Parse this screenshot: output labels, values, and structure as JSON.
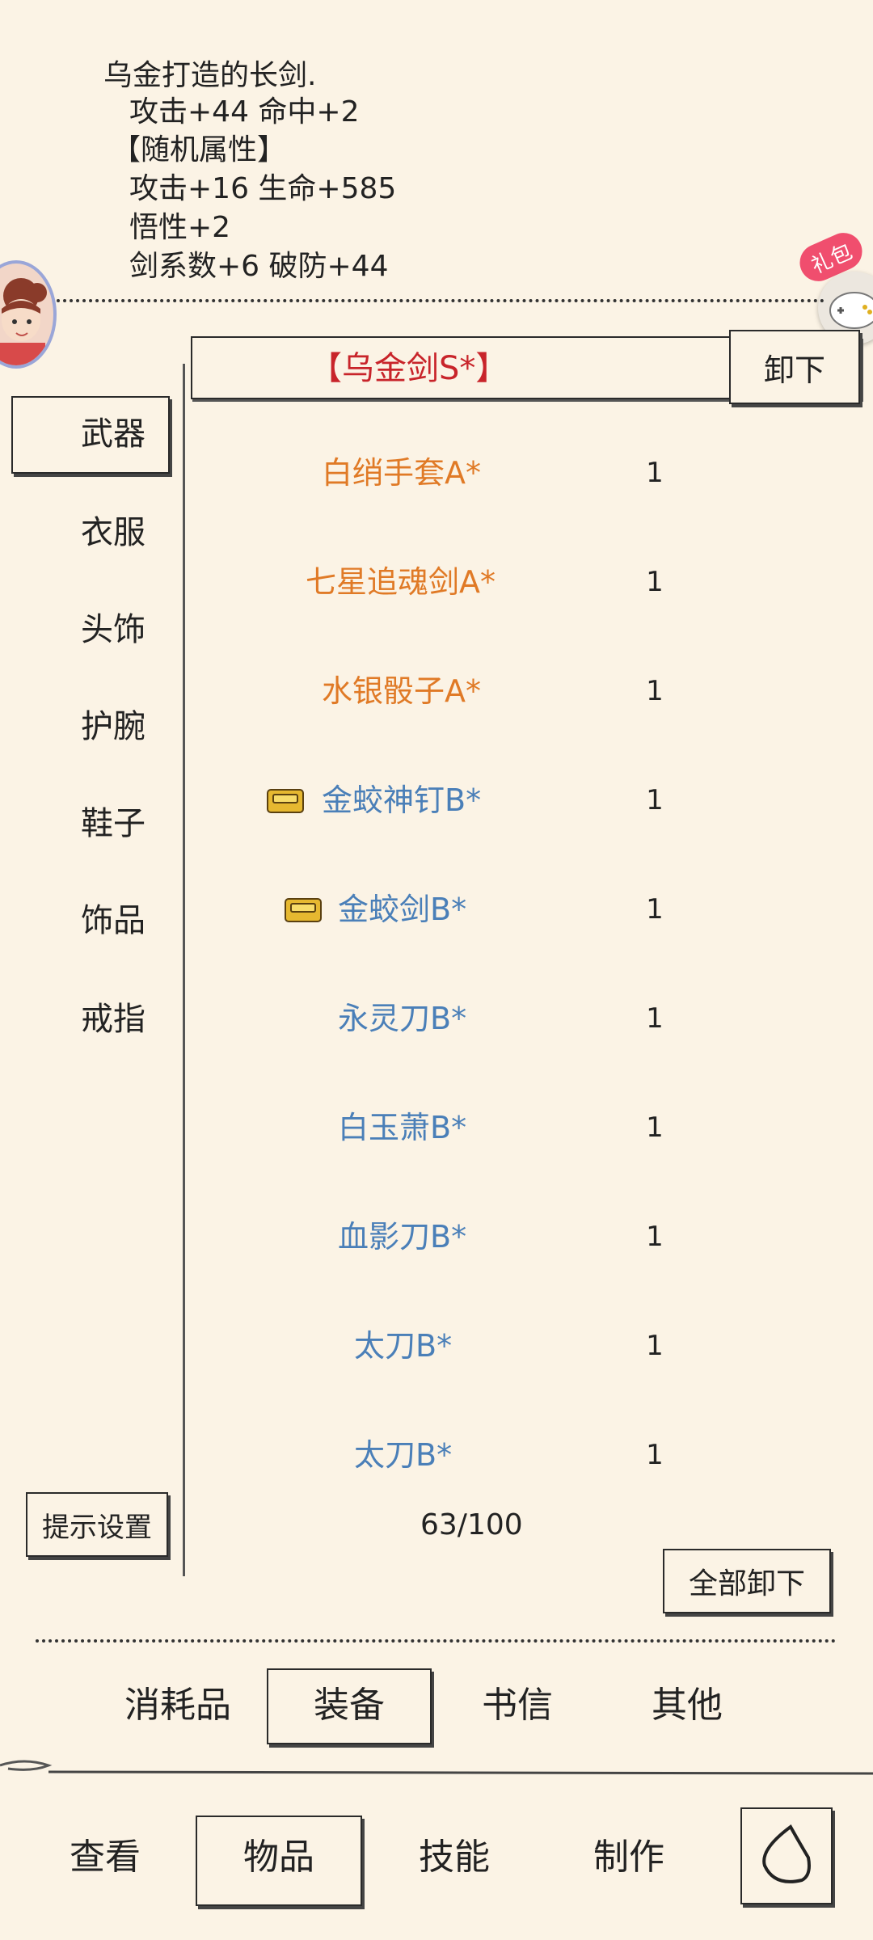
{
  "description": {
    "line1": "乌金打造的长剑.",
    "line2": "攻击+44 命中+2",
    "line3": "【随机属性】",
    "line4": "攻击+16 生命+585",
    "line5": "悟性+2",
    "line6": "剑系数+6 破防+44"
  },
  "gift_badge": "礼包",
  "equipped": {
    "name": "【乌金剑S*】",
    "unequip_label": "卸下"
  },
  "categories": [
    {
      "label": "武器",
      "selected": true
    },
    {
      "label": "衣服"
    },
    {
      "label": "头饰"
    },
    {
      "label": "护腕"
    },
    {
      "label": "鞋子"
    },
    {
      "label": "饰品"
    },
    {
      "label": "戒指"
    }
  ],
  "items": [
    {
      "name": "白绡手套A*",
      "qty": "1",
      "color": "#e07a26",
      "icon": null
    },
    {
      "name": "七星追魂剑A*",
      "qty": "1",
      "color": "#e07a26",
      "icon": null
    },
    {
      "name": "水银骰子A*",
      "qty": "1",
      "color": "#e07a26",
      "icon": null
    },
    {
      "name": "金蛟神钉B*",
      "qty": "1",
      "color": "#4a7fb8",
      "icon": "gold-ingot-icon"
    },
    {
      "name": "金蛟剑B*",
      "qty": "1",
      "color": "#4a7fb8",
      "icon": "gold-ingot-icon"
    },
    {
      "name": "永灵刀B*",
      "qty": "1",
      "color": "#4a7fb8",
      "icon": null
    },
    {
      "name": "白玉萧B*",
      "qty": "1",
      "color": "#4a7fb8",
      "icon": null
    },
    {
      "name": "血影刀B*",
      "qty": "1",
      "color": "#4a7fb8",
      "icon": null
    },
    {
      "name": "太刀B*",
      "qty": "1",
      "color": "#4a7fb8",
      "icon": null
    },
    {
      "name": "太刀B*",
      "qty": "1",
      "color": "#4a7fb8",
      "icon": null
    }
  ],
  "hint_settings_label": "提示设置",
  "capacity": "63/100",
  "unequip_all_label": "全部卸下",
  "sub_tabs": [
    {
      "label": "消耗品"
    },
    {
      "label": "装备",
      "selected": true
    },
    {
      "label": "书信"
    },
    {
      "label": "其他"
    }
  ],
  "main_tabs": [
    {
      "label": "查看"
    },
    {
      "label": "物品",
      "selected": true
    },
    {
      "label": "技能"
    },
    {
      "label": "制作"
    }
  ],
  "colors": {
    "background": "#fbf3e5",
    "equipped_name": "#c8242a",
    "rarity_a": "#e07a26",
    "rarity_b": "#4a7fb8",
    "gift_badge": "#f04e6e"
  }
}
